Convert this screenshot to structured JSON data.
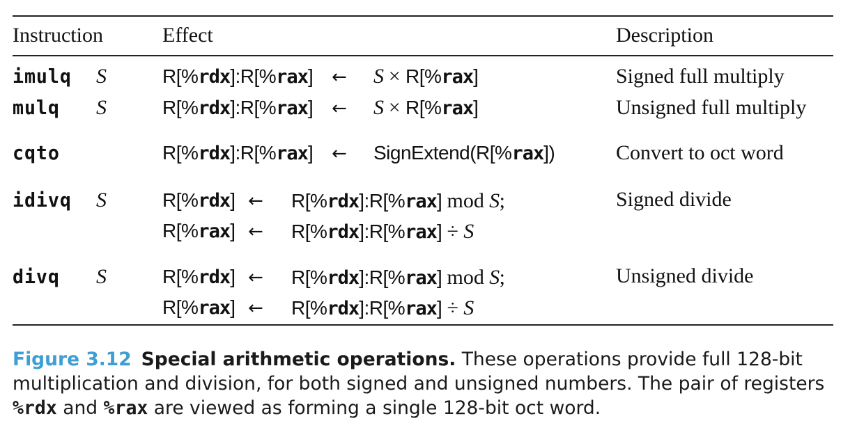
{
  "table": {
    "headers": {
      "instruction": "Instruction",
      "effect": "Effect",
      "description": "Description"
    },
    "rows": [
      {
        "mnemonic": "imulq",
        "operand": "S",
        "effect_lines": [
          {
            "dest": "R[%rdx]:R[%rax]",
            "arrow": "←",
            "expr": "S × R[%rax]"
          }
        ],
        "description": "Signed full multiply"
      },
      {
        "mnemonic": "mulq",
        "operand": "S",
        "effect_lines": [
          {
            "dest": "R[%rdx]:R[%rax]",
            "arrow": "←",
            "expr": "S × R[%rax]"
          }
        ],
        "description": "Unsigned full multiply"
      },
      {
        "mnemonic": "cqto",
        "operand": "",
        "effect_lines": [
          {
            "dest": "R[%rdx]:R[%rax]",
            "arrow": "←",
            "expr": "SignExtend(R[%rax])"
          }
        ],
        "description": "Convert to oct word"
      },
      {
        "mnemonic": "idivq",
        "operand": "S",
        "effect_lines": [
          {
            "dest": "R[%rdx]",
            "arrow": "←",
            "expr": "R[%rdx]:R[%rax] mod S;"
          },
          {
            "dest": "R[%rax]",
            "arrow": "←",
            "expr": "R[%rdx]:R[%rax] ÷ S"
          }
        ],
        "description": "Signed divide"
      },
      {
        "mnemonic": "divq",
        "operand": "S",
        "effect_lines": [
          {
            "dest": "R[%rdx]",
            "arrow": "←",
            "expr": "R[%rdx]:R[%rax] mod S;"
          },
          {
            "dest": "R[%rax]",
            "arrow": "←",
            "expr": "R[%rdx]:R[%rax] ÷ S"
          }
        ],
        "description": "Unsigned divide"
      }
    ]
  },
  "caption": {
    "figure_label": "Figure 3.12",
    "title": "Special arithmetic operations.",
    "text_1": " These operations provide full 128-bit multiplication and division, for both signed and unsigned numbers. The pair of registers ",
    "reg_1": "%rdx",
    "text_2": " and ",
    "reg_2": "%rax",
    "text_3": " are viewed as forming a single 128-bit oct word.",
    "label_color": "#3d9fd3"
  },
  "tokens": {
    "R_open": "R[",
    "close": "]",
    "colon": ":",
    "pct": "%",
    "rdx": "rdx",
    "rax": "rax",
    "S": "S",
    "times": "×",
    "mod": "mod",
    "div": "÷",
    "semi": ";",
    "signextend_open": "SignExtend(",
    "paren_close": ")"
  }
}
